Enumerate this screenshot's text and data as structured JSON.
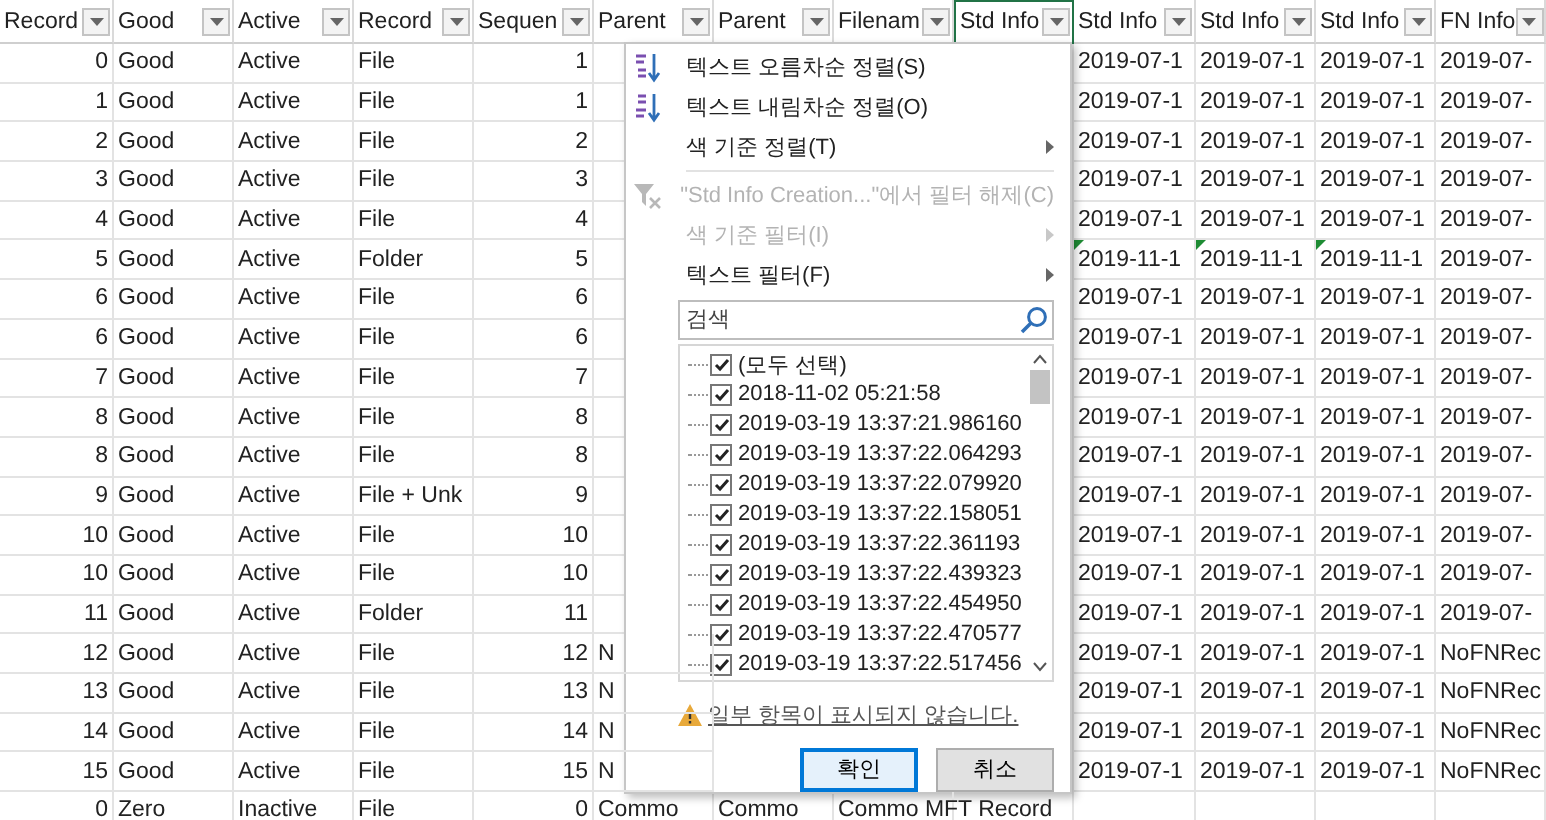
{
  "columns": [
    {
      "label": "Record",
      "kind": "number",
      "selected": false
    },
    {
      "label": "Good",
      "kind": "text",
      "selected": false
    },
    {
      "label": "Active",
      "kind": "text",
      "selected": false
    },
    {
      "label": "Record",
      "kind": "text",
      "selected": false
    },
    {
      "label": "Sequen",
      "kind": "number",
      "selected": false
    },
    {
      "label": "Parent",
      "kind": "text",
      "selected": false
    },
    {
      "label": "Parent",
      "kind": "text",
      "selected": false
    },
    {
      "label": "Filenam",
      "kind": "text",
      "selected": false
    },
    {
      "label": "Std Info",
      "kind": "date",
      "selected": true
    },
    {
      "label": "Std Info",
      "kind": "date",
      "selected": false
    },
    {
      "label": "Std Info",
      "kind": "date",
      "selected": false
    },
    {
      "label": "Std Info",
      "kind": "date",
      "selected": false
    },
    {
      "label": "FN Info",
      "kind": "text",
      "selected": false
    }
  ],
  "rows": [
    {
      "flagged": false,
      "cells": [
        "0",
        "Good",
        "Active",
        "File",
        "1",
        null,
        null,
        null,
        null,
        "2019-07-1",
        "2019-07-1",
        "2019-07-1",
        "2019-07-"
      ]
    },
    {
      "flagged": false,
      "cells": [
        "1",
        "Good",
        "Active",
        "File",
        "1",
        null,
        null,
        null,
        null,
        "2019-07-1",
        "2019-07-1",
        "2019-07-1",
        "2019-07-"
      ]
    },
    {
      "flagged": false,
      "cells": [
        "2",
        "Good",
        "Active",
        "File",
        "2",
        null,
        null,
        null,
        null,
        "2019-07-1",
        "2019-07-1",
        "2019-07-1",
        "2019-07-"
      ]
    },
    {
      "flagged": false,
      "cells": [
        "3",
        "Good",
        "Active",
        "File",
        "3",
        null,
        null,
        null,
        null,
        "2019-07-1",
        "2019-07-1",
        "2019-07-1",
        "2019-07-"
      ]
    },
    {
      "flagged": false,
      "cells": [
        "4",
        "Good",
        "Active",
        "File",
        "4",
        null,
        null,
        null,
        null,
        "2019-07-1",
        "2019-07-1",
        "2019-07-1",
        "2019-07-"
      ]
    },
    {
      "flagged": true,
      "cells": [
        "5",
        "Good",
        "Active",
        "Folder",
        "5",
        null,
        null,
        null,
        null,
        "2019-11-1",
        "2019-11-1",
        "2019-11-1",
        "2019-07-"
      ]
    },
    {
      "flagged": false,
      "cells": [
        "6",
        "Good",
        "Active",
        "File",
        "6",
        null,
        null,
        null,
        null,
        "2019-07-1",
        "2019-07-1",
        "2019-07-1",
        "2019-07-"
      ]
    },
    {
      "flagged": false,
      "cells": [
        "6",
        "Good",
        "Active",
        "File",
        "6",
        null,
        null,
        null,
        null,
        "2019-07-1",
        "2019-07-1",
        "2019-07-1",
        "2019-07-"
      ]
    },
    {
      "flagged": false,
      "cells": [
        "7",
        "Good",
        "Active",
        "File",
        "7",
        null,
        null,
        null,
        null,
        "2019-07-1",
        "2019-07-1",
        "2019-07-1",
        "2019-07-"
      ]
    },
    {
      "flagged": false,
      "cells": [
        "8",
        "Good",
        "Active",
        "File",
        "8",
        null,
        null,
        null,
        null,
        "2019-07-1",
        "2019-07-1",
        "2019-07-1",
        "2019-07-"
      ]
    },
    {
      "flagged": false,
      "cells": [
        "8",
        "Good",
        "Active",
        "File",
        "8",
        null,
        null,
        null,
        null,
        "2019-07-1",
        "2019-07-1",
        "2019-07-1",
        "2019-07-"
      ]
    },
    {
      "flagged": false,
      "cells": [
        "9",
        "Good",
        "Active",
        "File + Unk",
        "9",
        null,
        null,
        null,
        null,
        "2019-07-1",
        "2019-07-1",
        "2019-07-1",
        "2019-07-"
      ]
    },
    {
      "flagged": false,
      "cells": [
        "10",
        "Good",
        "Active",
        "File",
        "10",
        null,
        null,
        null,
        null,
        "2019-07-1",
        "2019-07-1",
        "2019-07-1",
        "2019-07-"
      ]
    },
    {
      "flagged": false,
      "cells": [
        "10",
        "Good",
        "Active",
        "File",
        "10",
        null,
        null,
        null,
        null,
        "2019-07-1",
        "2019-07-1",
        "2019-07-1",
        "2019-07-"
      ]
    },
    {
      "flagged": false,
      "cells": [
        "11",
        "Good",
        "Active",
        "Folder",
        "11",
        null,
        null,
        null,
        null,
        "2019-07-1",
        "2019-07-1",
        "2019-07-1",
        "2019-07-"
      ]
    },
    {
      "flagged": false,
      "cells": [
        "12",
        "Good",
        "Active",
        "File",
        "12",
        "N",
        null,
        null,
        null,
        "2019-07-1",
        "2019-07-1",
        "2019-07-1",
        "NoFNRec"
      ]
    },
    {
      "flagged": false,
      "cells": [
        "13",
        "Good",
        "Active",
        "File",
        "13",
        "N",
        null,
        null,
        null,
        "2019-07-1",
        "2019-07-1",
        "2019-07-1",
        "NoFNRec"
      ]
    },
    {
      "flagged": false,
      "cells": [
        "14",
        "Good",
        "Active",
        "File",
        "14",
        "N",
        null,
        null,
        null,
        "2019-07-1",
        "2019-07-1",
        "2019-07-1",
        "NoFNRec"
      ]
    },
    {
      "flagged": false,
      "cells": [
        "15",
        "Good",
        "Active",
        "File",
        "15",
        "N",
        null,
        null,
        null,
        "2019-07-1",
        "2019-07-1",
        "2019-07-1",
        "NoFNRec"
      ]
    },
    {
      "flagged": false,
      "cells": [
        "0",
        "Zero",
        "Inactive",
        "File",
        "0",
        "Commo",
        "Commo",
        "Commo MFT Record",
        null,
        null,
        null,
        null,
        null
      ]
    }
  ],
  "filter_menu": {
    "items": [
      {
        "kind": "sort-ascending",
        "label": "텍스트 오름차순 정렬(S)",
        "disabled": false,
        "submenu": false
      },
      {
        "kind": "sort-descending",
        "label": "텍스트 내림차순 정렬(O)",
        "disabled": false,
        "submenu": false
      },
      {
        "kind": "plain",
        "label": "색 기준 정렬(T)",
        "disabled": false,
        "submenu": true
      },
      {
        "kind": "separator"
      },
      {
        "kind": "clear-filter",
        "label": "\"Std Info Creation...\"에서 필터 해제(C)",
        "disabled": true,
        "submenu": false
      },
      {
        "kind": "plain",
        "label": "색 기준 필터(I)",
        "disabled": true,
        "submenu": true
      },
      {
        "kind": "plain",
        "label": "텍스트 필터(F)",
        "disabled": false,
        "submenu": true
      }
    ],
    "search": {
      "placeholder": "검색"
    },
    "values": [
      {
        "label": "(모두 선택)",
        "checked": true
      },
      {
        "label": "2018-11-02 05:21:58",
        "checked": true
      },
      {
        "label": "2019-03-19 13:37:21.986160",
        "checked": true
      },
      {
        "label": "2019-03-19 13:37:22.064293",
        "checked": true
      },
      {
        "label": "2019-03-19 13:37:22.079920",
        "checked": true
      },
      {
        "label": "2019-03-19 13:37:22.158051",
        "checked": true
      },
      {
        "label": "2019-03-19 13:37:22.361193",
        "checked": true
      },
      {
        "label": "2019-03-19 13:37:22.439323",
        "checked": true
      },
      {
        "label": "2019-03-19 13:37:22.454950",
        "checked": true
      },
      {
        "label": "2019-03-19 13:37:22.470577",
        "checked": true
      },
      {
        "label": "2019-03-19 13:37:22.517456",
        "checked": true
      }
    ],
    "warning": "일부 항목이 표시되지 않습니다.",
    "buttons": [
      "확인",
      "취소"
    ]
  }
}
